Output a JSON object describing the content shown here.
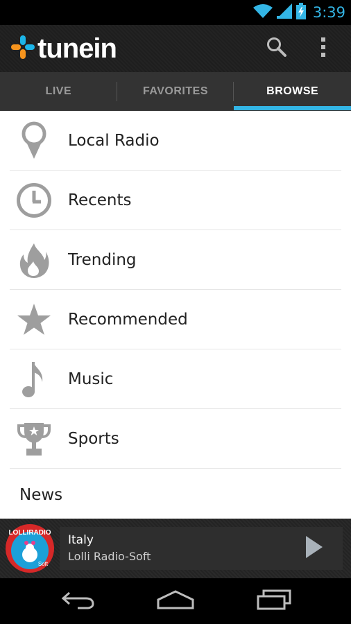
{
  "status_bar": {
    "time": "3:39"
  },
  "app": {
    "logo_text": "tunein"
  },
  "tabs": [
    {
      "label": "LIVE",
      "active": false
    },
    {
      "label": "FAVORITES",
      "active": false
    },
    {
      "label": "BROWSE",
      "active": true
    }
  ],
  "browse_items": [
    {
      "label": "Local Radio",
      "icon": "location-pin-icon"
    },
    {
      "label": "Recents",
      "icon": "clock-icon"
    },
    {
      "label": "Trending",
      "icon": "flame-icon"
    },
    {
      "label": "Recommended",
      "icon": "star-icon"
    },
    {
      "label": "Music",
      "icon": "music-note-icon"
    },
    {
      "label": "Sports",
      "icon": "trophy-icon"
    },
    {
      "label": "News",
      "icon": ""
    }
  ],
  "now_playing": {
    "title": "Italy",
    "station": "Lolli Radio-Soft",
    "logo_text": "LOLLIRADIO",
    "logo_sub": "Soft"
  },
  "colors": {
    "accent": "#33b5e5",
    "icon_gray": "#9e9e9e",
    "logo_orange": "#f7941d",
    "logo_blue": "#1cb5e8"
  }
}
